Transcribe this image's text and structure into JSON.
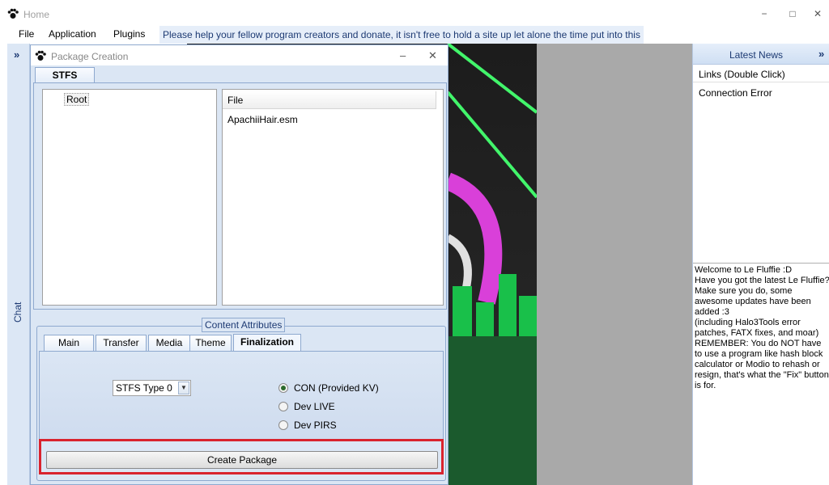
{
  "window": {
    "title": "Home",
    "controls": {
      "minimize": "−",
      "maximize": "□",
      "close": "✕"
    }
  },
  "menubar": {
    "items": [
      "File",
      "Application",
      "Plugins"
    ],
    "notice": "Please help your fellow program creators and donate, it isn't free to hold a site up let alone the time put into this"
  },
  "left_panel": {
    "collapse": "»",
    "chat_label": "Chat"
  },
  "news": {
    "title": "Latest News",
    "collapse": "»",
    "links_label": "Links (Double Click)",
    "connection_status": "Connection Error",
    "welcome_text": "Welcome to Le Fluffie :D\nHave you got the latest Le Fluffie?\nMake sure you do, some awesome updates have been added :3\n(including Halo3Tools error patches, FATX fixes, and moar)\nREMEMBER: You do NOT have to use a program like hash block calculator or Modio to rehash or resign, that's what the \"Fix\" button is for."
  },
  "dialog": {
    "title": "Package Creation",
    "controls": {
      "minimize": "–",
      "close": "✕"
    },
    "main_tab": "STFS",
    "tree": {
      "root": "Root"
    },
    "file_list": {
      "column": "File",
      "rows": [
        "ApachiiHair.esm"
      ]
    },
    "attributes": {
      "legend": "Content Attributes",
      "tabs": [
        "Main",
        "Transfer",
        "Media",
        "Theme",
        "Finalization"
      ],
      "active_tab": "Finalization",
      "stfs_type": "STFS Type 0",
      "radios": [
        {
          "label": "CON (Provided KV)",
          "checked": true
        },
        {
          "label": "Dev LIVE",
          "checked": false
        },
        {
          "label": "Dev PIRS",
          "checked": false
        }
      ]
    },
    "create_button": "Create Package"
  },
  "colors": {
    "accent_border": "#d9232e",
    "panel_blue": "#dbe6f4",
    "header_blue": "#1d3a73"
  }
}
